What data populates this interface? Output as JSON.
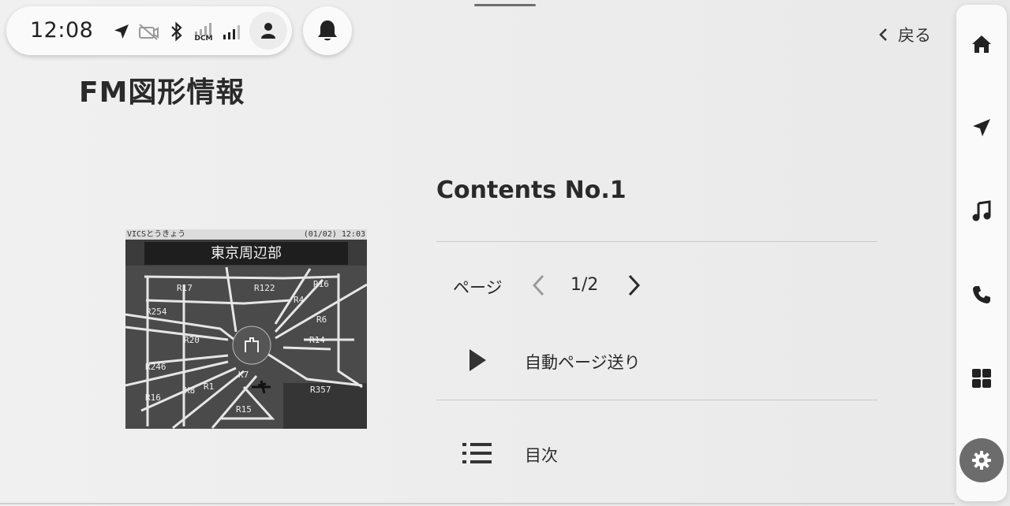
{
  "status_bar": {
    "time": "12:08",
    "icons": [
      "location-arrow-icon",
      "camera-off-icon",
      "bluetooth-icon",
      "dcm-signal-icon",
      "cell-signal-icon",
      "user-icon"
    ],
    "dcm_label": "DCM"
  },
  "notifications": {
    "icon": "bell-icon"
  },
  "header": {
    "title": "FM図形情報",
    "back_label": "戻る"
  },
  "map_image": {
    "header_left": "VICSとうきょう",
    "header_right": "(01/02)  12:03",
    "region": "東京周辺部",
    "labels": [
      "R17",
      "R122",
      "R16",
      "R4",
      "R254",
      "R6",
      "R20",
      "R14",
      "R246",
      "K7",
      "K8",
      "R1",
      "R357",
      "R16",
      "R15"
    ]
  },
  "contents": {
    "title": "Contents No.1",
    "page_label": "ページ",
    "page_current": "1/2",
    "auto_page_label": "自動ページ送り",
    "toc_label": "目次"
  },
  "sidebar": {
    "items": [
      "home-icon",
      "navigation-icon",
      "music-icon",
      "phone-icon",
      "apps-grid-icon",
      "settings-icon"
    ],
    "active": "settings-icon"
  }
}
